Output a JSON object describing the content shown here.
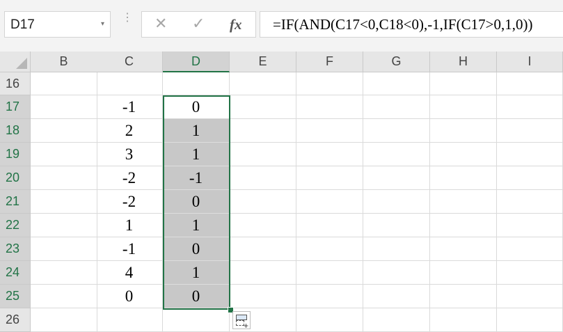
{
  "formula_bar": {
    "name_box": "D17",
    "dropdown_glyph": "▾",
    "more_glyph": "⋮",
    "cancel_glyph": "✕",
    "enter_glyph": "✓",
    "fx_label": "fx",
    "formula": "=IF(AND(C17<0,C18<0),-1,IF(C17>0,1,0))"
  },
  "columns": [
    "B",
    "C",
    "D",
    "E",
    "F",
    "G",
    "H",
    "I"
  ],
  "selected_column": "D",
  "rows": [
    {
      "num": "16",
      "c": "",
      "d": ""
    },
    {
      "num": "17",
      "c": "-1",
      "d": "0"
    },
    {
      "num": "18",
      "c": "2",
      "d": "1"
    },
    {
      "num": "19",
      "c": "3",
      "d": "1"
    },
    {
      "num": "20",
      "c": "-2",
      "d": "-1"
    },
    {
      "num": "21",
      "c": "-2",
      "d": "0"
    },
    {
      "num": "22",
      "c": "1",
      "d": "1"
    },
    {
      "num": "23",
      "c": "-1",
      "d": "0"
    },
    {
      "num": "24",
      "c": "4",
      "d": "1"
    },
    {
      "num": "25",
      "c": "0",
      "d": "0"
    },
    {
      "num": "26",
      "c": "",
      "d": ""
    }
  ],
  "selection": {
    "range": "D17:D25",
    "active_cell": "D17"
  },
  "icons": {
    "quick_analysis": "quick-analysis-icon",
    "select_all": "select-all-triangle-icon"
  },
  "colors": {
    "accent": "#217346",
    "selection_fill": "#c8c8c8"
  }
}
